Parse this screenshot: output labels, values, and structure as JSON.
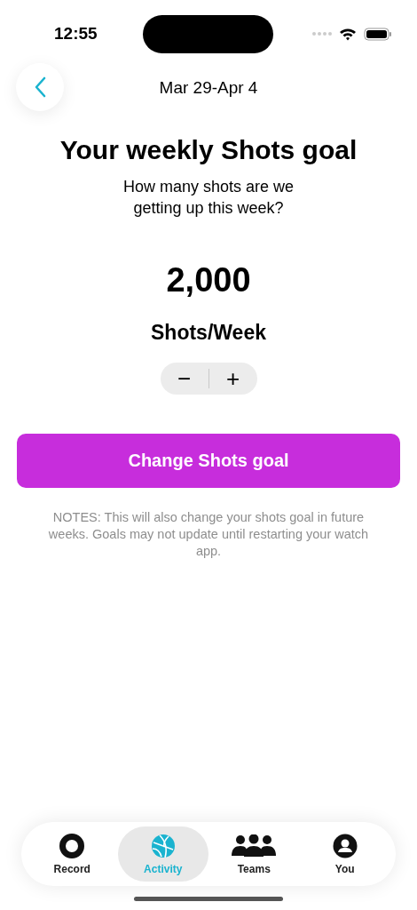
{
  "status_bar": {
    "time": "12:55"
  },
  "nav": {
    "date_range": "Mar 29-Apr 4"
  },
  "goal": {
    "title": "Your weekly Shots goal",
    "question": "How many shots are we getting up this week?",
    "value": "2,000",
    "unit": "Shots/Week",
    "stepper": [
      "−",
      "+"
    ]
  },
  "action_button": "Change Shots goal",
  "notes": "NOTES: This will also change your shots goal in future weeks. Goals may not update until restarting your watch app.",
  "tabs": [
    {
      "label": "Record",
      "kind": "record",
      "selected": false
    },
    {
      "label": "Activity",
      "kind": "ball",
      "selected": true
    },
    {
      "label": "Teams",
      "kind": "people",
      "selected": false
    },
    {
      "label": "You",
      "kind": "person",
      "selected": false
    }
  ]
}
